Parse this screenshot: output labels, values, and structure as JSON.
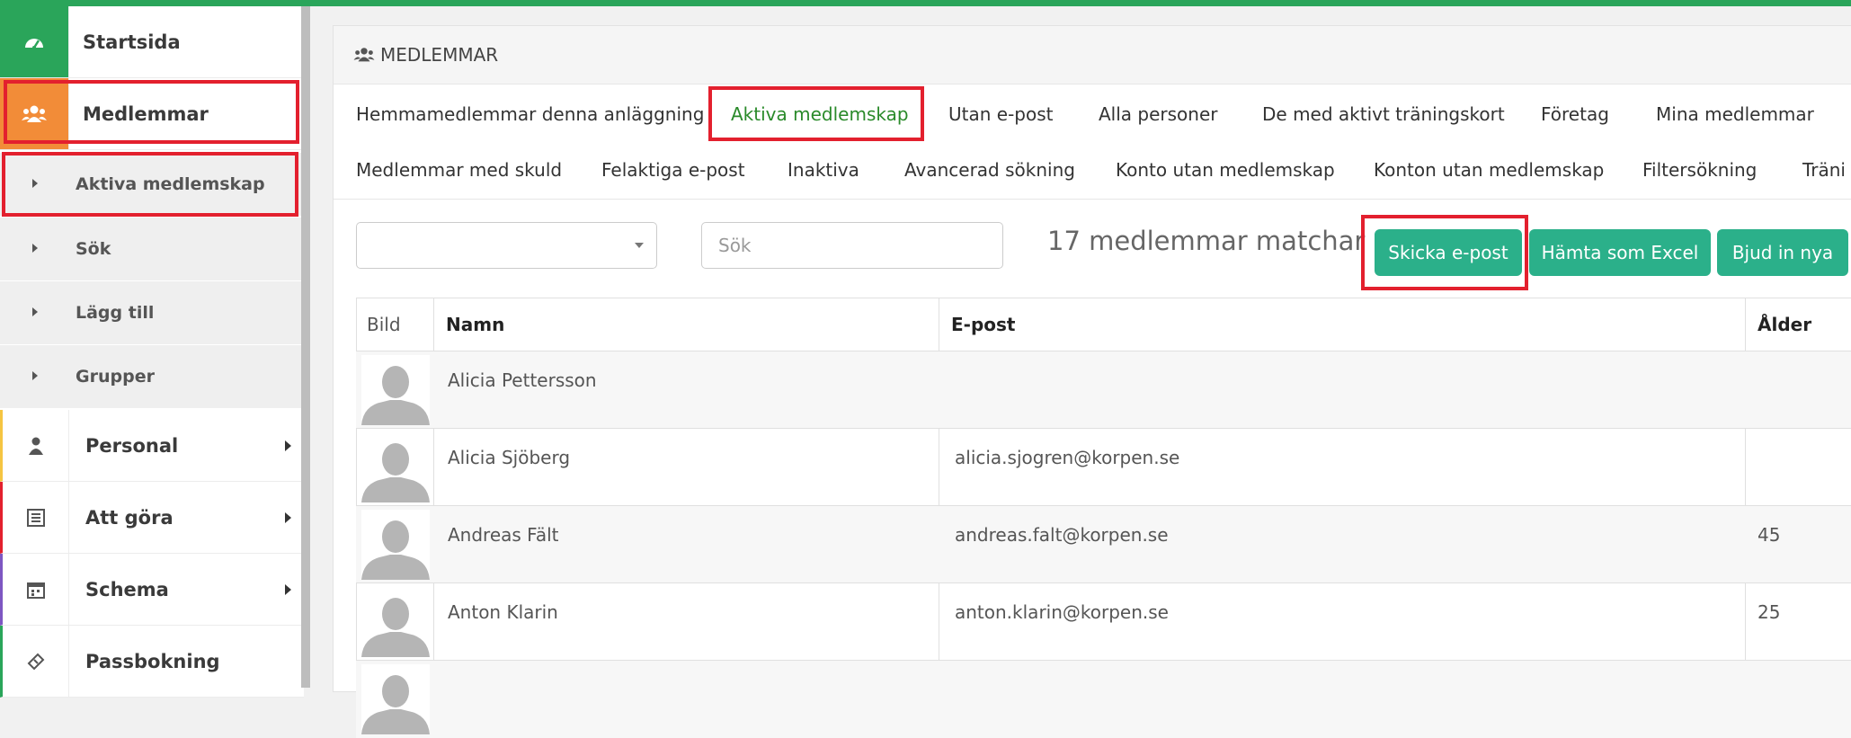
{
  "sidebar": {
    "items": [
      {
        "label": "Startsida",
        "icon": "dashboard-icon"
      },
      {
        "label": "Medlemmar",
        "icon": "users-icon"
      },
      {
        "label": "Personal",
        "icon": "user-icon"
      },
      {
        "label": "Att göra",
        "icon": "list-icon"
      },
      {
        "label": "Schema",
        "icon": "calendar-icon"
      },
      {
        "label": "Passbokning",
        "icon": "ticket-icon"
      }
    ],
    "subitems": [
      {
        "label": "Aktiva medlemskap"
      },
      {
        "label": "Sök"
      },
      {
        "label": "Lägg till"
      },
      {
        "label": "Grupper"
      }
    ]
  },
  "panel": {
    "title": "MEDLEMMAR",
    "tabs_row1": [
      "Hemmamedlemmar denna anläggning",
      "Aktiva medlemskap",
      "Utan e-post",
      "Alla personer",
      "De med aktivt träningskort",
      "Företag",
      "Mina medlemmar"
    ],
    "tabs_row2": [
      "Medlemmar med skuld",
      "Felaktiga e-post",
      "Inaktiva",
      "Avancerad sökning",
      "Konto utan medlemskap",
      "Konton utan medlemskap",
      "Filtersökning",
      "Träni"
    ]
  },
  "toolbar": {
    "search_placeholder": "Sök",
    "match_count": "17 medlemmar matchar",
    "btn_email": "Skicka e-post",
    "btn_excel": "Hämta som Excel",
    "btn_invite": "Bjud in nya"
  },
  "table": {
    "headers": {
      "bild": "Bild",
      "namn": "Namn",
      "epost": "E-post",
      "alder": "Ålder"
    },
    "rows": [
      {
        "name": "Alicia Pettersson",
        "email": "",
        "age": ""
      },
      {
        "name": "Alicia Sjöberg",
        "email": "alicia.sjogren@korpen.se",
        "age": ""
      },
      {
        "name": "Andreas Fält",
        "email": "andreas.falt@korpen.se",
        "age": "45"
      },
      {
        "name": "Anton Klarin",
        "email": "anton.klarin@korpen.se",
        "age": "25"
      }
    ]
  },
  "colors": {
    "accent": "#2bb08a",
    "active_tab": "#2a8a2a",
    "highlight": "#e3202e",
    "topbar": "#2aa55a",
    "medlemmar_icon_bg": "#f28c38",
    "startsida_icon_bg": "#2aa55a"
  }
}
